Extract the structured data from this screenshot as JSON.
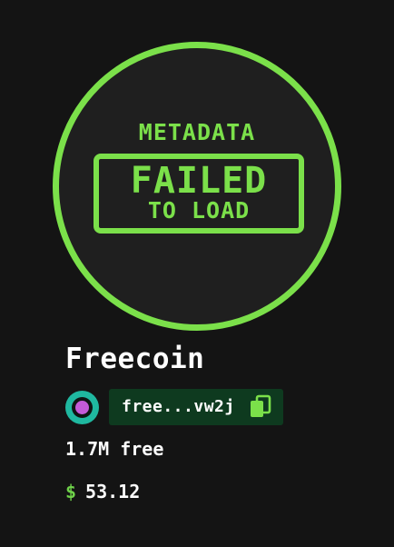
{
  "badge": {
    "line1": "METADATA",
    "line2": "FAILED",
    "line3": "TO LOAD"
  },
  "token": {
    "name": "Freecoin",
    "address_short": "free...vw2j",
    "supply": "1.7M free",
    "currency_symbol": "$",
    "price": "53.12"
  },
  "icons": {
    "logo": "token-logo-icon",
    "copy": "copy-icon"
  },
  "colors": {
    "accent": "#7be04a",
    "background": "#141414",
    "address_bg": "#0e3a1f",
    "logo_ring": "#1fb8a0",
    "logo_dot": "#c45ad8"
  }
}
